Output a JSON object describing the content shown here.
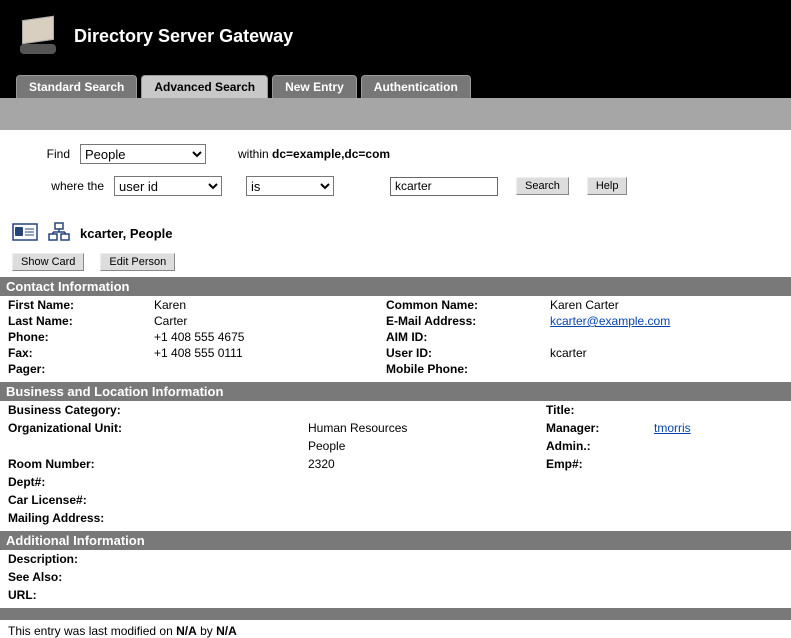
{
  "header": {
    "title": "Directory Server Gateway"
  },
  "tabs": {
    "standard": "Standard Search",
    "advanced": "Advanced Search",
    "newentry": "New Entry",
    "auth": "Authentication"
  },
  "search": {
    "find_label": "Find",
    "find_value": "People",
    "within_label": "within",
    "within_value": "dc=example,dc=com",
    "where_label": "where the",
    "attr_value": "user id",
    "op_value": "is",
    "query_value": "kcarter",
    "search_btn": "Search",
    "help_btn": "Help"
  },
  "result": {
    "heading": "kcarter, People",
    "showcard_btn": "Show Card",
    "editperson_btn": "Edit Person"
  },
  "sections": {
    "contact": "Contact Information",
    "business": "Business and Location Information",
    "additional": "Additional Information"
  },
  "contact": {
    "labels": {
      "firstname": "First Name:",
      "lastname": "Last Name:",
      "phone": "Phone:",
      "fax": "Fax:",
      "pager": "Pager:",
      "commonname": "Common Name:",
      "email": "E-Mail Address:",
      "aim": "AIM ID:",
      "userid": "User ID:",
      "mobile": "Mobile Phone:"
    },
    "values": {
      "firstname": "Karen",
      "lastname": "Carter",
      "phone": "+1 408 555 4675",
      "fax": "+1 408 555 0111",
      "pager": "",
      "commonname": "Karen Carter",
      "email": "kcarter@example.com",
      "aim": "",
      "userid": "kcarter",
      "mobile": ""
    }
  },
  "business": {
    "labels": {
      "category": "Business Category:",
      "orgunit": "Organizational Unit:",
      "room": "Room Number:",
      "dept": "Dept#:",
      "carlicense": "Car License#:",
      "mailing": "Mailing Address:",
      "title": "Title:",
      "manager": "Manager:",
      "admin": "Admin.:",
      "emp": "Emp#:"
    },
    "values": {
      "category": "",
      "orgunit_line1": "Human Resources",
      "orgunit_line2": "People",
      "room": "2320",
      "dept": "",
      "carlicense": "",
      "mailing": "",
      "title": "",
      "manager": "tmorris",
      "admin": "",
      "emp": ""
    }
  },
  "additional": {
    "labels": {
      "description": "Description:",
      "seealso": "See Also:",
      "url": "URL:"
    }
  },
  "footer": {
    "prefix": "This entry was last modified on ",
    "date": "N/A",
    "mid": " by ",
    "author": "N/A"
  }
}
